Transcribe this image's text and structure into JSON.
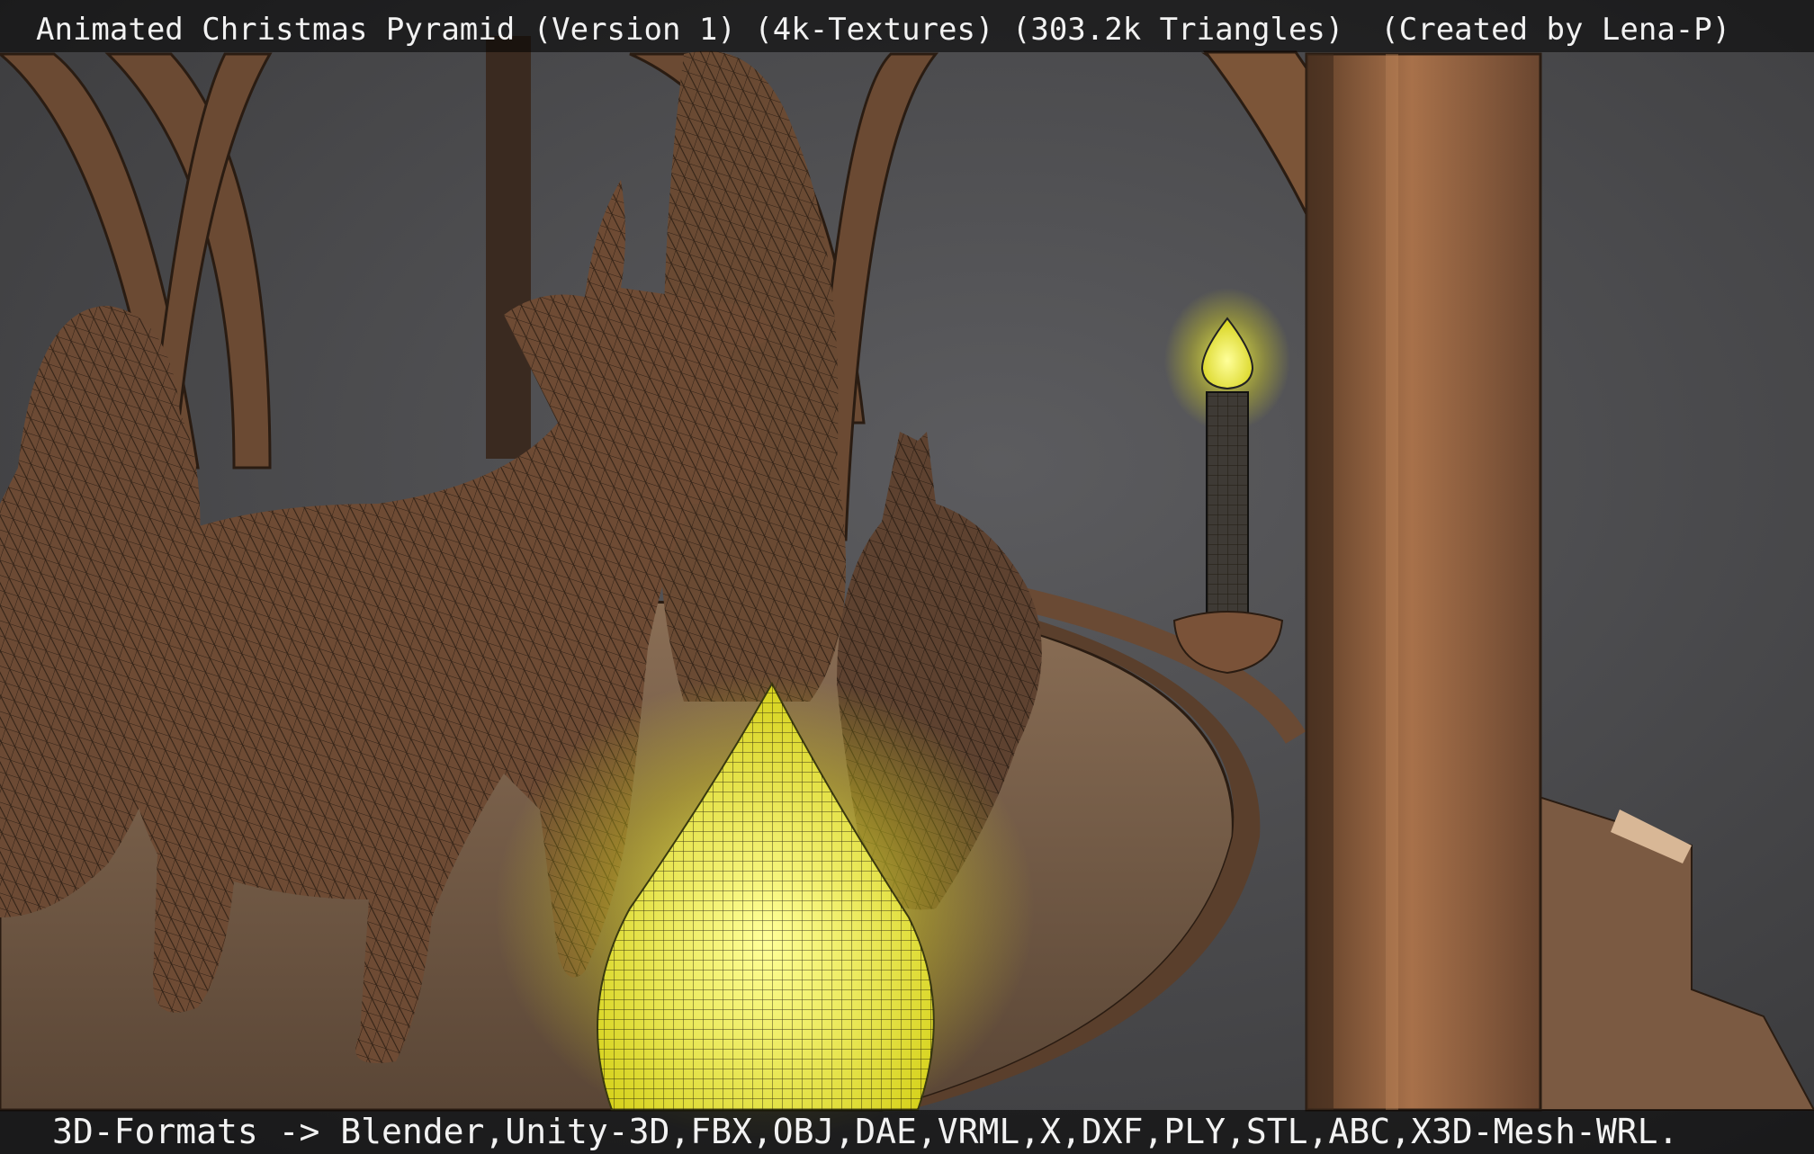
{
  "header": {
    "title": "Animated Christmas Pyramid (Version 1) (4k-Textures) (303.2k Triangles)  (Created by Lena-P)"
  },
  "footer": {
    "formats": "3D-Formats -> Blender,Unity-3D,FBX,OBJ,DAE,VRML,X,DXF,PLY,STL,ABC,X3D-Mesh-WRL."
  },
  "scene": {
    "subject": "wireframe render of a wooden christmas pyramid with carved animals and glowing candles",
    "colors": {
      "background": "#4a4a4c",
      "wood": "#7a5a40",
      "dark_wood": "#4e3526",
      "glow": "#f4f020"
    }
  }
}
